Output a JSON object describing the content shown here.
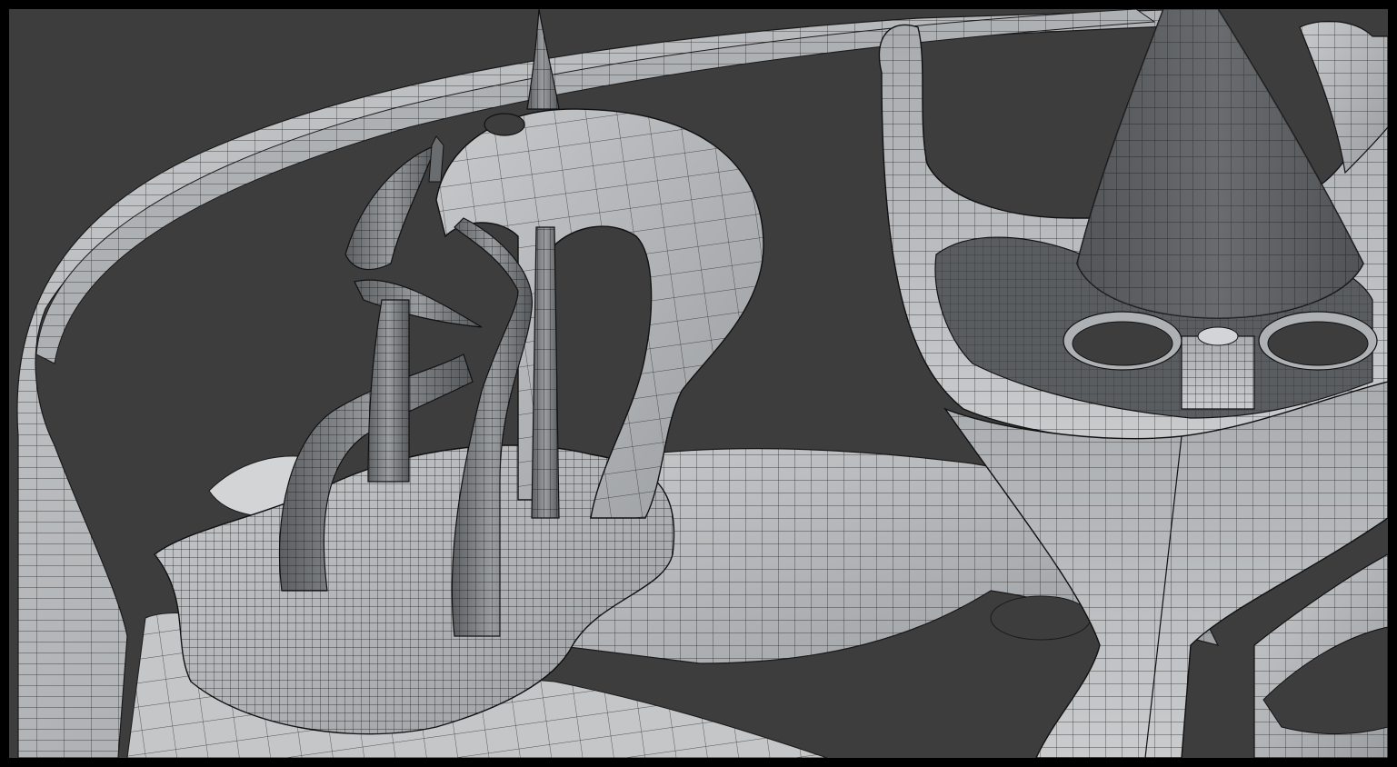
{
  "viewport": {
    "label": "",
    "background_color": "#3d3d3d",
    "frame_color": "#000000",
    "shading": "solid-gray-with-wireframe",
    "mesh_fill_color": "#b9bcbe",
    "mesh_shadow_color": "#6f7275",
    "wire_color": "#1a1a1a"
  },
  "scene": {
    "objects": [
      "outer-ring",
      "left-tower-base",
      "left-tower-arch",
      "left-tower-spike",
      "left-tower-curved-horns",
      "left-tower-tubes",
      "bridge-platform",
      "right-tower-bowl",
      "right-tower-cone",
      "right-tower-oval-holes",
      "right-tower-stem-legs"
    ]
  }
}
